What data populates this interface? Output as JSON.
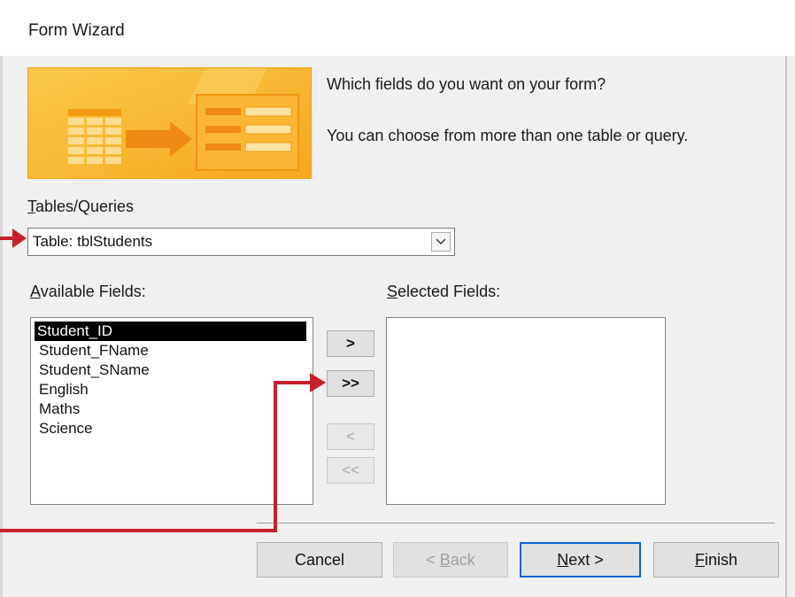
{
  "window": {
    "title": "Form Wizard"
  },
  "header": {
    "question": "Which fields do you want on your form?",
    "hint": "You can choose from more than one table or query."
  },
  "tables_queries": {
    "label_accel": "T",
    "label_rest": "ables/Queries",
    "selected": "Table: tblStudents"
  },
  "available": {
    "label_accel": "A",
    "label_rest": "vailable Fields:",
    "items": [
      "Student_ID",
      "Student_FName",
      "Student_SName",
      "English",
      "Maths",
      "Science"
    ],
    "selected_index": 0
  },
  "selected_fields": {
    "label_accel": "S",
    "label_rest": "elected Fields:",
    "items": []
  },
  "move_buttons": {
    "add_one": ">",
    "add_all": ">>",
    "remove_one": "<",
    "remove_all": "<<"
  },
  "footer": {
    "cancel": "Cancel",
    "back_prefix": "< ",
    "back_accel": "B",
    "back_rest": "ack",
    "next_accel": "N",
    "next_rest": "ext >",
    "finish_accel": "F",
    "finish_rest": "inish"
  },
  "colors": {
    "annotation_arrow": "#c8202a",
    "illustration_orange": "#f7b52a",
    "selection": "#000000",
    "default_button_border": "#0a64d2"
  }
}
